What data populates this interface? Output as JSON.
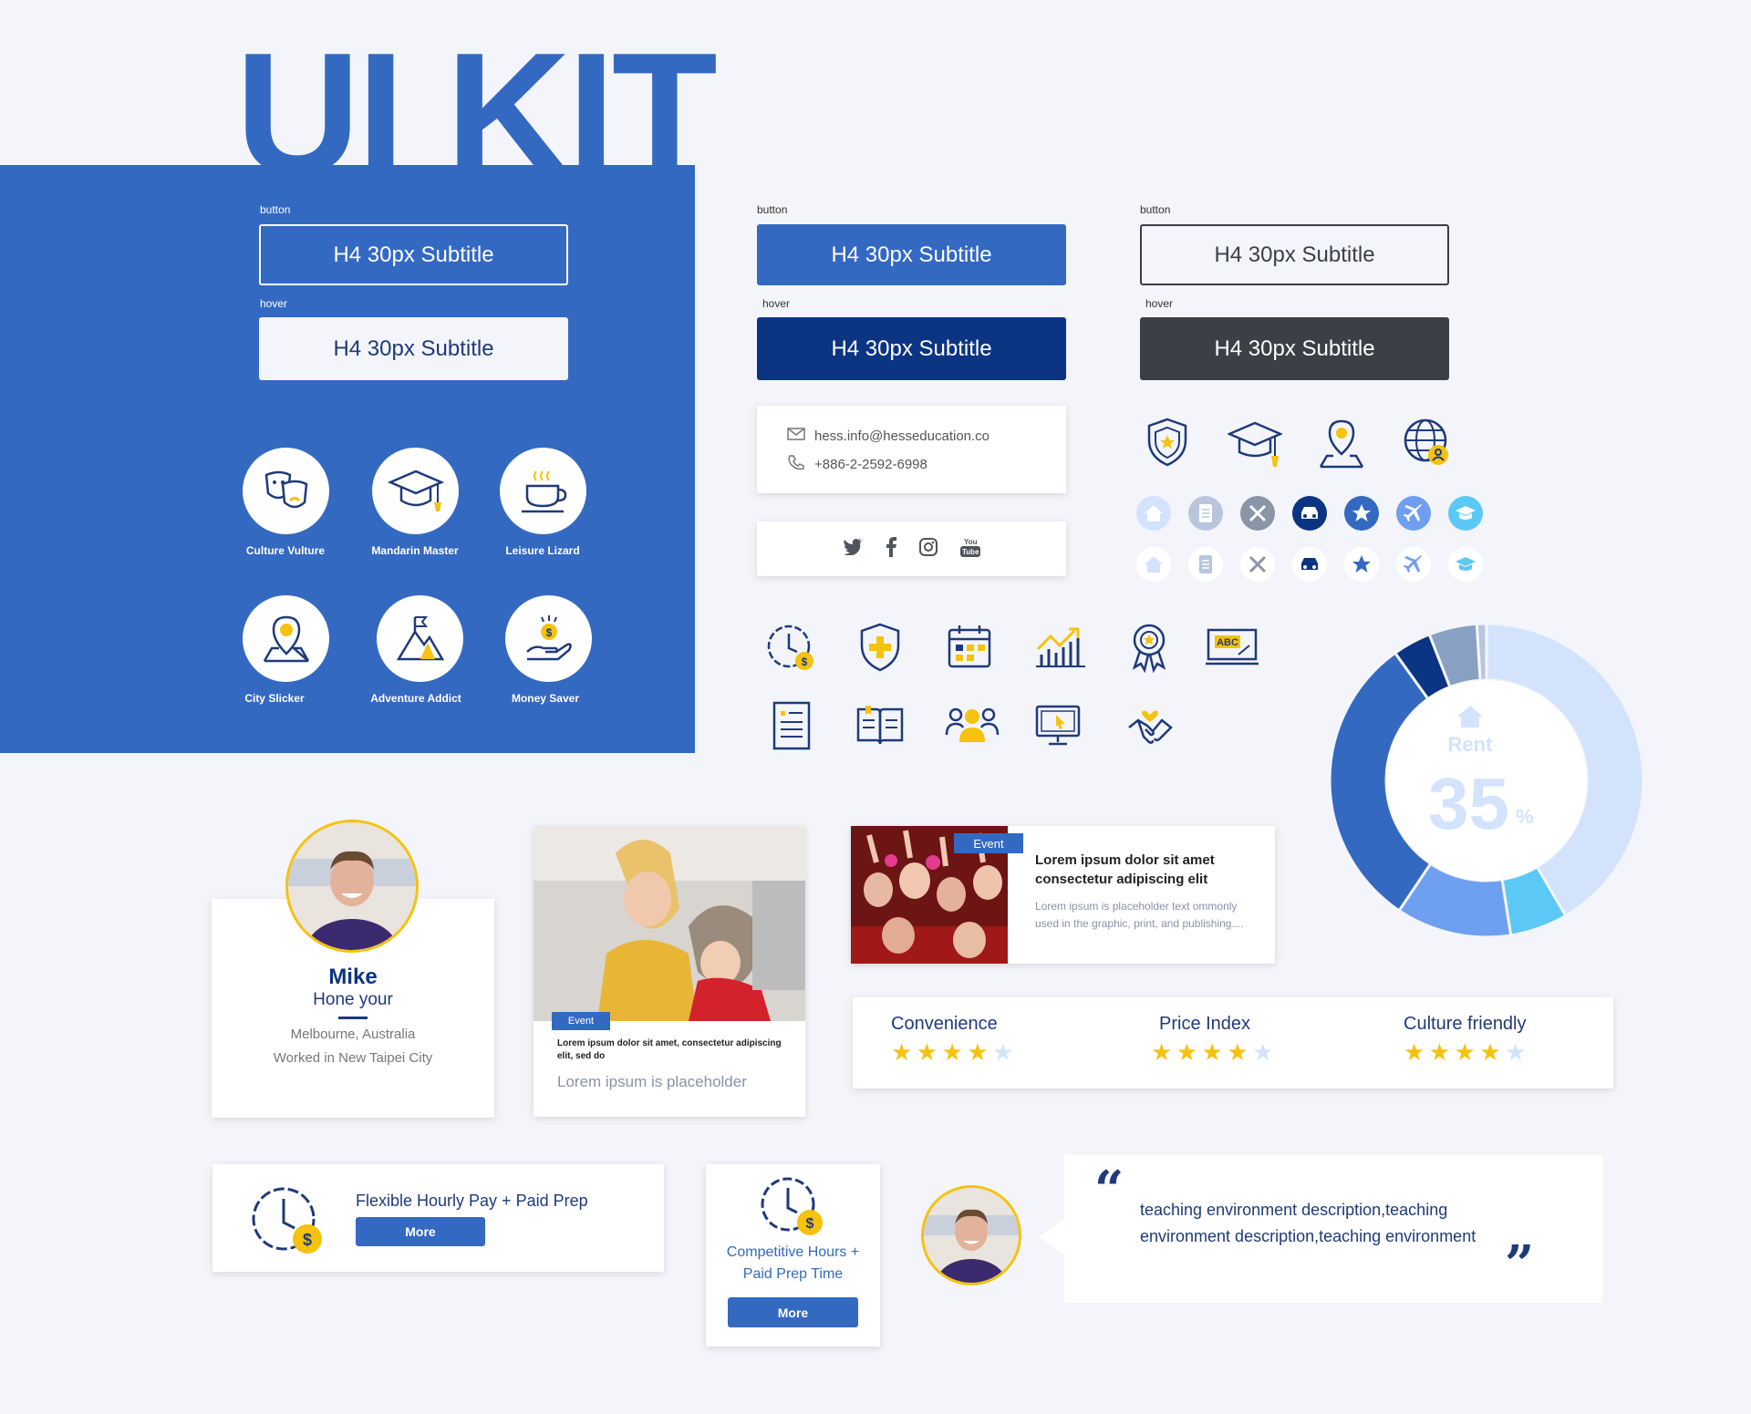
{
  "title": "UI KIT",
  "colors": {
    "primary": "#3469c2",
    "navy": "#0b3482",
    "yellow": "#f5c20f",
    "dark": "#3c3f45",
    "light": "#d3e3fc"
  },
  "buttons": {
    "label_button": "button",
    "label_hover": "hover",
    "text": "H4  30px Subtitle"
  },
  "badges": [
    {
      "name": "culture-vulture",
      "label": "Culture Vulture",
      "icon": "masks-icon"
    },
    {
      "name": "mandarin-master",
      "label": "Mandarin Master",
      "icon": "graduation-cap-icon"
    },
    {
      "name": "leisure-lizard",
      "label": "Leisure Lizard",
      "icon": "coffee-cup-icon"
    },
    {
      "name": "city-slicker",
      "label": "City Slicker",
      "icon": "map-pin-icon"
    },
    {
      "name": "adventure-addict",
      "label": "Adventure Addict",
      "icon": "mountain-flag-icon"
    },
    {
      "name": "money-saver",
      "label": "Money Saver",
      "icon": "money-hand-icon"
    }
  ],
  "contact": {
    "email": "hess.info@hesseducation.co",
    "phone": "+886-2-2592-6998"
  },
  "social": [
    "twitter-icon",
    "facebook-icon",
    "instagram-icon",
    "youtube-icon"
  ],
  "profile": {
    "name": "Mike",
    "subtitle": "Hone your",
    "location": "Melbourne, Australia",
    "work": "Worked in New Taipei City"
  },
  "event_card": {
    "tag": "Event",
    "headline": "Lorem ipsum dolor sit amet, consectetur adipiscing elit, sed do",
    "sub": "Lorem ipsum is placeholder"
  },
  "event_row": {
    "tag": "Event",
    "headline": "Lorem ipsum dolor sit amet consectetur adipiscing elit",
    "body": "Lorem ipsum is placeholder text ommonly used in the graphic, print, and publishing...."
  },
  "ratings": [
    {
      "label": "Convenience",
      "value": 4,
      "max": 5
    },
    {
      "label": "Price Index",
      "value": 4,
      "max": 5
    },
    {
      "label": "Culture friendly",
      "value": 4,
      "max": 5
    }
  ],
  "donut": {
    "label": "Rent",
    "value": "35",
    "unit": "%"
  },
  "chart_data": {
    "type": "pie",
    "values": [
      42,
      6,
      12,
      31,
      4,
      5,
      1
    ],
    "colors": [
      "#d3e3fc",
      "#5cc8f5",
      "#6f9ff1",
      "#3469c2",
      "#0b3482",
      "#8aa0c2",
      "#b8c6dc"
    ]
  },
  "feature_pay": {
    "title": "Flexible Hourly Pay + Paid Prep",
    "button": "More"
  },
  "feature_hours": {
    "line1": "Competitive Hours +",
    "line2": "Paid Prep Time",
    "button": "More"
  },
  "quote": {
    "text_line1": "teaching environment description,teaching",
    "text_line2": "environment description,teaching environment",
    "open": "“",
    "close": "”"
  }
}
